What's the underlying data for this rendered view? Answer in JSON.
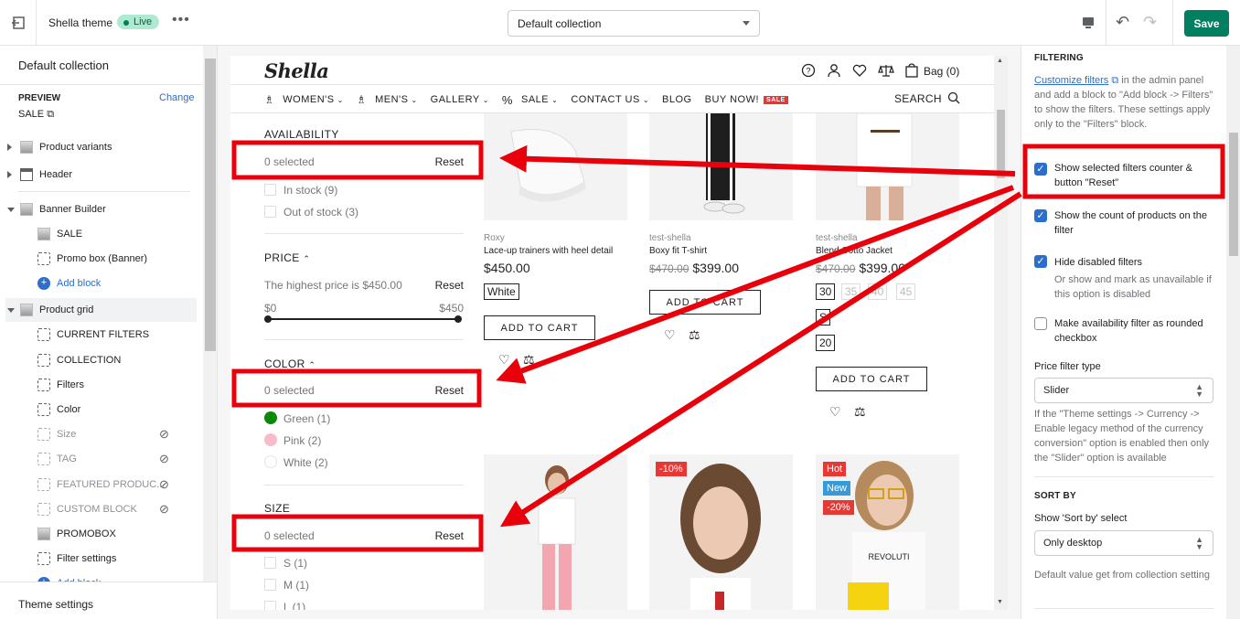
{
  "topbar": {
    "theme_name": "Shella theme",
    "live_badge": "Live",
    "more": "•••",
    "collection_select": "Default collection",
    "save_label": "Save"
  },
  "leftbar": {
    "title": "Default collection",
    "preview_label": "PREVIEW",
    "change_label": "Change",
    "preview_value": "SALE",
    "items": [
      {
        "label": "Product variants",
        "icon": "image-icon"
      },
      {
        "label": "Header",
        "icon": "header-icon"
      },
      {
        "label": "Banner Builder",
        "icon": "image-icon"
      },
      {
        "label": "SALE",
        "icon": "image-icon"
      },
      {
        "label": "Promo box (Banner)",
        "icon": "dashed-box-icon"
      },
      {
        "label": "Add block",
        "icon": "plus-circle-icon"
      },
      {
        "label": "Product grid",
        "icon": "image-icon"
      },
      {
        "label": "CURRENT FILTERS",
        "icon": "dashed-box-icon"
      },
      {
        "label": "COLLECTION",
        "icon": "dashed-box-icon"
      },
      {
        "label": "Filters",
        "icon": "dashed-box-icon"
      },
      {
        "label": "Color",
        "icon": "dashed-box-icon"
      },
      {
        "label": "Size",
        "icon": "dashed-box-icon"
      },
      {
        "label": "TAG",
        "icon": "dashed-box-icon"
      },
      {
        "label": "FEATURED PRODUC...",
        "icon": "dashed-box-icon"
      },
      {
        "label": "CUSTOM BLOCK",
        "icon": "dashed-box-icon"
      },
      {
        "label": "PROMOBOX",
        "icon": "image-icon"
      },
      {
        "label": "Filter settings",
        "icon": "dashed-box-icon"
      },
      {
        "label": "Add block",
        "icon": "plus-circle-icon"
      }
    ],
    "footer": "Theme settings"
  },
  "store": {
    "logo": "Shella",
    "bag": "Bag (0)",
    "nav": [
      "WOMEN'S",
      "MEN'S",
      "GALLERY",
      "SALE",
      "CONTACT US",
      "BLOG",
      "BUY NOW!"
    ],
    "nav_sale_tag": "SALE",
    "search": "SEARCH",
    "filters": {
      "availability_title": "AVAILABILITY",
      "availability_selected": "0 selected",
      "reset": "Reset",
      "in_stock": "In stock (9)",
      "out_of_stock": "Out of stock (3)",
      "price_title": "PRICE",
      "price_highest": "The highest price is $450.00",
      "price_min": "$0",
      "price_max": "$450",
      "color_title": "COLOR",
      "color_selected": "0 selected",
      "colors": [
        {
          "label": "Green (1)",
          "hex": "#0a8a0a"
        },
        {
          "label": "Pink (2)",
          "hex": "#f8bcc8"
        },
        {
          "label": "White (2)",
          "hex": "#ffffff"
        }
      ],
      "size_title": "SIZE",
      "size_selected": "0 selected",
      "sizes": [
        "S (1)",
        "M (1)",
        "L (1)"
      ]
    },
    "products": [
      {
        "brand": "Roxy",
        "name": "Lace-up trainers with heel detail",
        "price": "$450.00",
        "old_price": "",
        "variants": [
          "White"
        ],
        "cta": "ADD TO CART"
      },
      {
        "brand": "test-shella",
        "name": "Boxy fit T-shirt",
        "price": "$399.00",
        "old_price": "$470.00",
        "variants": [],
        "cta": "ADD TO CART"
      },
      {
        "brand": "test-shella",
        "name": "Blend Cotto Jacket",
        "price": "$399.00",
        "old_price": "$470.00",
        "variants": [
          "30",
          "35",
          "40",
          "45",
          "S",
          "20"
        ],
        "cta": "ADD TO CART"
      }
    ],
    "labels": {
      "discount": "-10%",
      "hot": "Hot",
      "new": "New",
      "discount2": "-20%"
    }
  },
  "rightbar": {
    "filtering_title": "FILTERING",
    "customize_link": "Customize filters",
    "customize_text": " in the admin panel and add a block to \"Add block -> Filters\" to show the filters. These settings apply only to the \"Filters\" block.",
    "opt1": "Show selected filters counter & button \"Reset\"",
    "opt2": "Show the count of products on the filter",
    "opt3": "Hide disabled filters",
    "opt3_help": "Or show and mark as unavailable if this option is disabled",
    "opt4": "Make availability filter as rounded checkbox",
    "price_type_label": "Price filter type",
    "price_type_value": "Slider",
    "price_help": "If the \"Theme settings -> Currency -> Enable legacy method of the currency conversion\" option is enabled then only the \"Slider\" option is available",
    "sortby_title": "SORT BY",
    "sortby_label": "Show 'Sort by' select",
    "sortby_value": "Only desktop",
    "sortby_help": "Default value get from collection setting"
  },
  "colors": {
    "accent": "#008060",
    "link": "#2c6ecb",
    "annotation": "#e8000b",
    "sale_label": "#e53935",
    "new_label": "#3a9ad9"
  }
}
